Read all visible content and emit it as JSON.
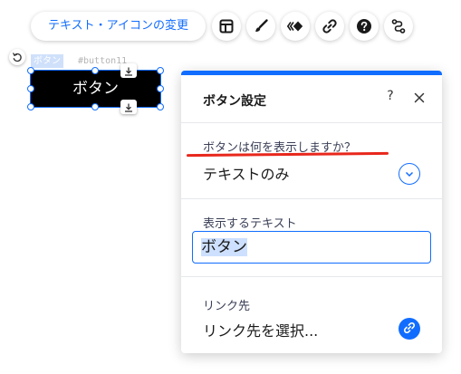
{
  "toolbar": {
    "change_text_icon_label": "テキスト・アイコンの変更",
    "buttons": [
      {
        "icon": "layout-icon"
      },
      {
        "icon": "paint-brush-icon"
      },
      {
        "icon": "animation-icon"
      },
      {
        "icon": "link-icon"
      },
      {
        "icon": "help-icon"
      },
      {
        "icon": "connect-icon"
      }
    ]
  },
  "canvas": {
    "element_type_label": "ボタン",
    "element_id": "#button11",
    "button_text": "ボタン"
  },
  "panel": {
    "title": "ボタン設定",
    "help_label": "?",
    "display": {
      "label": "ボタンは何を表示しますか？",
      "value": "テキストのみ"
    },
    "text_field": {
      "label": "表示するテキスト",
      "value": "ボタン"
    },
    "link": {
      "label": "リンク先",
      "value": "リンク先を選択..."
    }
  },
  "colors": {
    "accent": "#116dff",
    "annotation_underline": "#e8271c",
    "button_background": "#000000",
    "button_text": "#ffffff"
  }
}
